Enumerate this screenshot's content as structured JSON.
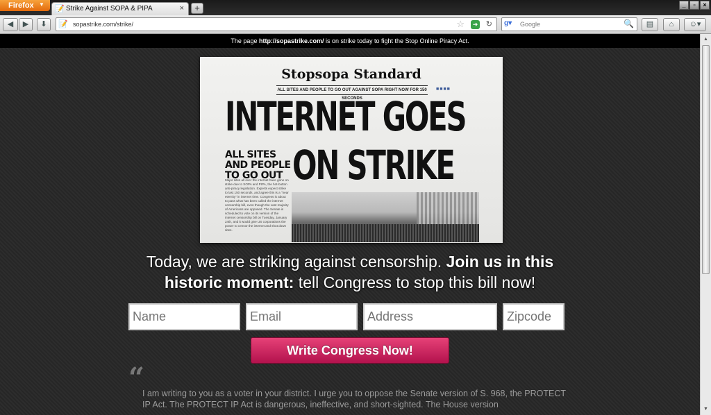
{
  "browser": {
    "menu_button": "Firefox",
    "tab_title": "Strike Against SOPA & PIPA",
    "new_tab": "+",
    "url": "sopastrike.com/strike/",
    "search_placeholder": "Google",
    "window_controls": [
      "_",
      "▫",
      "×"
    ]
  },
  "info_bar": {
    "prefix": "The page ",
    "link": "http://sopastrike.com/",
    "suffix": " is on strike today to fight the Stop Online Piracy Act."
  },
  "newspaper": {
    "masthead": "Stopsopa Standard",
    "tagline": "ALL SITES AND PEOPLE TO GO OUT AGAINST SOPA RIGHT NOW FOR 150 SECONDS",
    "headline_line1": "INTERNET GOES",
    "subhead": "ALL SITES AND PEOPLE TO GO OUT",
    "headline_line2": "ON STRIKE",
    "body": "Major sites all over the internet have gone on strike due to SOPA and PIPA, the hot-button anti-piracy legislation. Experts expect strike to last 150 seconds, and agree this is a \"near eternity\" in internet time. Congress is about to pass what has been called the internet censorship bill, even though the vast majority of Americans are opposed. The Senate is scheduled to vote on its version of the internet censorship bill on Tuesday, January 24th, and it would give US corporations the power to censor the internet and shut down sites."
  },
  "page": {
    "headline_part1": "Today, we are striking against censorship. ",
    "headline_bold1": "Join us in this",
    "headline_bold2": "historic moment:",
    "headline_part2": " tell Congress to stop this bill now!",
    "form": {
      "name_placeholder": "Name",
      "email_placeholder": "Email",
      "address_placeholder": "Address",
      "zipcode_placeholder": "Zipcode",
      "submit_label": "Write Congress Now!"
    },
    "quote_mark": "“",
    "letter_text": "I am writing to you as a voter in your district. I urge you to oppose the Senate version of S. 968, the PROTECT IP Act. The PROTECT IP Act is dangerous, ineffective, and short-sighted. The House version"
  }
}
